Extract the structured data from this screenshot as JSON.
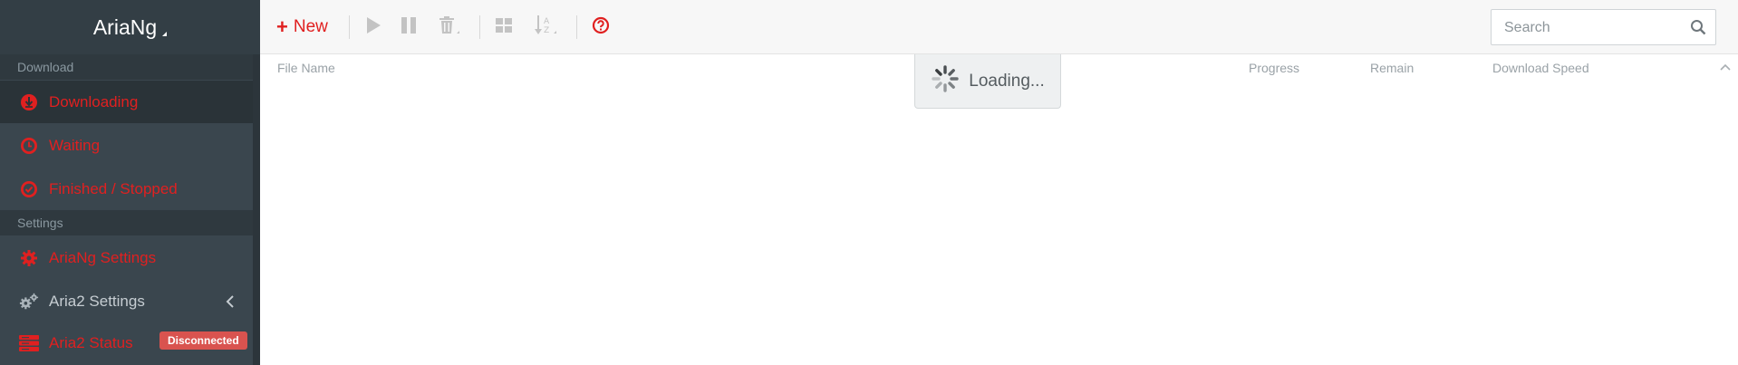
{
  "brand": {
    "name": "AriaNg"
  },
  "sidebar": {
    "sections": [
      {
        "title": "Download"
      },
      {
        "title": "Settings"
      }
    ],
    "download_items": [
      {
        "label": "Downloading"
      },
      {
        "label": "Waiting"
      },
      {
        "label": "Finished / Stopped"
      }
    ],
    "settings_items": [
      {
        "label": "AriaNg Settings"
      },
      {
        "label": "Aria2 Settings"
      },
      {
        "label": "Aria2 Status"
      }
    ],
    "status_badge": "Disconnected"
  },
  "toolbar": {
    "new_label": "New",
    "icons": [
      "start-icon",
      "pause-icon",
      "delete-icon",
      "select-all-icon",
      "sort-icon",
      "help-icon"
    ]
  },
  "search": {
    "placeholder": "Search",
    "value": ""
  },
  "table": {
    "columns": [
      "File Name",
      "Progress",
      "Remain",
      "Download Speed"
    ]
  },
  "loading": {
    "text": "Loading..."
  },
  "colors": {
    "accent": "#e02020",
    "sidebar_bg": "#3a464e",
    "badge": "#d9534f"
  }
}
